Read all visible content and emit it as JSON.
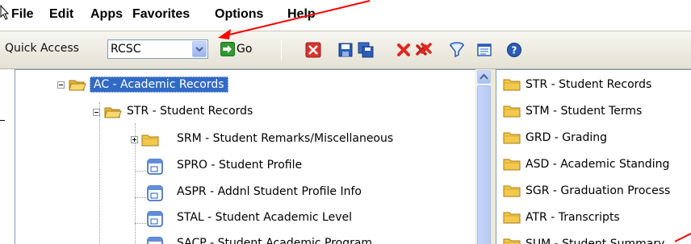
{
  "menu": {
    "items": [
      "File",
      "Edit",
      "Apps",
      "Favorites",
      "Options",
      "Help"
    ]
  },
  "toolbar": {
    "quick_access_label": "Quick Access",
    "quick_access_value": "RCSC",
    "go_label": "Go"
  },
  "tree": {
    "nodes": [
      {
        "label": "AC - Academic Records",
        "selected": true
      },
      {
        "label": "STR - Student Records"
      },
      {
        "label": "SRM - Student Remarks/Miscellaneous"
      },
      {
        "label": "SPRO - Student Profile"
      },
      {
        "label": "ASPR - Addnl Student Profile Info"
      },
      {
        "label": "STAL - Student Academic Level"
      },
      {
        "label": "SACP - Student Academic Program"
      }
    ]
  },
  "list": {
    "items": [
      "STR - Student Records",
      "STM - Student Terms",
      "GRD - Grading",
      "ASD - Academic Standing",
      "SGR - Graduation Process",
      "ATR - Transcripts",
      "SUM - Student Summary"
    ]
  },
  "colors": {
    "selection": "#316ac5",
    "annotation_arrow": "#ff0000",
    "folder": "#f2c94c"
  }
}
